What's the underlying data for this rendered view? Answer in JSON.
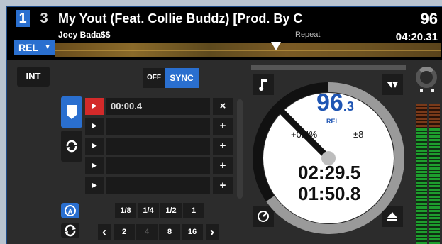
{
  "header": {
    "deck_active": "1",
    "deck_other": "3",
    "rel_label": "REL",
    "title": "My Yout (Feat. Collie Buddz) [Prod. By C",
    "artist": "Joey Bada$$",
    "repeat_label": "Repeat",
    "bpm": "96",
    "time_remaining": "04:20.31"
  },
  "controls": {
    "int_label": "INT",
    "off_label": "OFF",
    "sync_label": "SYNC"
  },
  "cues": [
    {
      "time": "00:00.4",
      "action": "×",
      "active": true
    },
    {
      "time": "",
      "action": "+",
      "active": false
    },
    {
      "time": "",
      "action": "+",
      "active": false
    },
    {
      "time": "",
      "action": "+",
      "active": false
    },
    {
      "time": "",
      "action": "+",
      "active": false
    }
  ],
  "loop": {
    "fractions": [
      "1/8",
      "1/4",
      "1/2",
      "1"
    ],
    "lengths": [
      "2",
      "4",
      "8",
      "16"
    ],
    "prev": "‹",
    "next": "›"
  },
  "turntable": {
    "bpm_int": "96",
    "bpm_dec": ".3",
    "rel": "REL",
    "pitch": "+0.4%",
    "range": "±8",
    "elapsed": "02:29.5",
    "remaining": "01:50.8"
  },
  "colors": {
    "accent": "#2a6fcf",
    "cue_red": "#d32a2a",
    "bpm_blue": "#1f55b3",
    "meter_green": "#1e9e2e"
  },
  "icons": {
    "note": "note-icon",
    "pitch_mode": "pitch-mode-icon",
    "keylock": "keylock-icon",
    "eject": "eject-icon",
    "cue_marker": "cue-marker-icon",
    "loop_roll": "loop-roll-icon",
    "auto_loop": "auto-loop-icon",
    "loop": "loop-icon"
  }
}
